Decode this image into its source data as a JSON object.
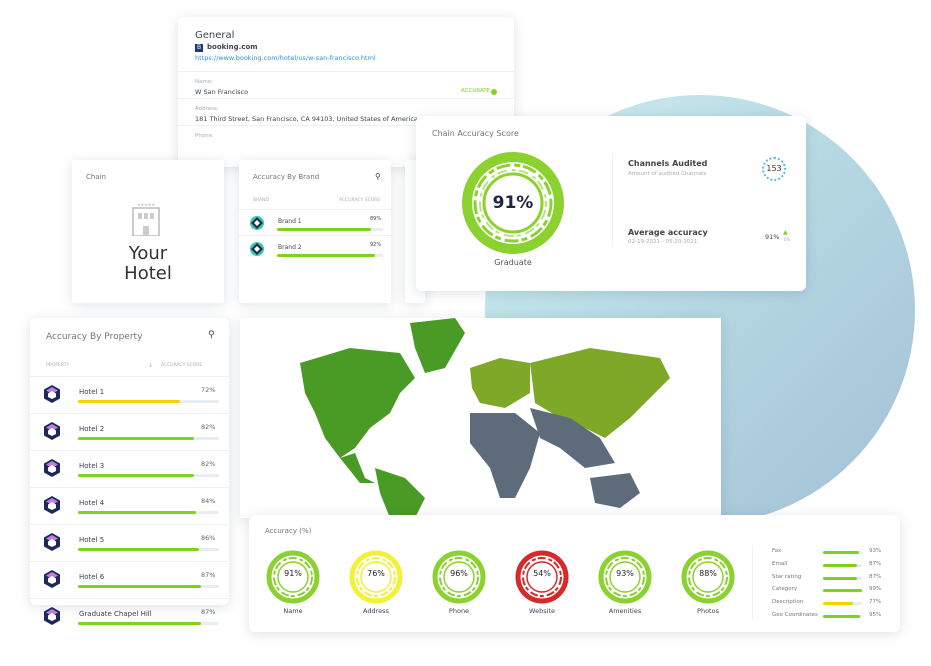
{
  "general": {
    "title": "General",
    "source": "booking.com",
    "url": "https://www.booking.com/hotel/us/w-san-francisco.html",
    "name_label": "Name:",
    "name_value": "W San Francisco",
    "status": "ACCURATE",
    "address_label": "Address:",
    "address_value": "181 Third Street, San Francisco, CA 94103, United States of America",
    "phone_label": "Phone:"
  },
  "chain": {
    "title": "Chain",
    "logo_line1": "Your",
    "logo_line2": "Hotel"
  },
  "brand": {
    "title": "Accuracy By Brand",
    "col_brand": "BRAND",
    "col_score": "ACCURACY SCORE",
    "rows": [
      {
        "name": "Brand 1",
        "score": "89%",
        "value": 89
      },
      {
        "name": "Brand 2",
        "score": "92%",
        "value": 92
      }
    ]
  },
  "chain_score": {
    "title": "Chain Accuracy Score",
    "score": "91%",
    "value": 91,
    "tier": "Graduate",
    "channels_title": "Channels Audited",
    "channels_sub": "Amount of audited Channels",
    "channels_count": "153",
    "avg_title": "Average accuracy",
    "avg_range": "02-19-2021 - 05-20-2021",
    "avg_value": "91%",
    "avg_change": "0%"
  },
  "property": {
    "title": "Accuracy By Property",
    "col_property": "PROPERTY",
    "col_score": "ACCURACY SCORE",
    "rows": [
      {
        "name": "Hotel 1",
        "score": "72%",
        "value": 72,
        "color": "#f5d300"
      },
      {
        "name": "Hotel 2",
        "score": "82%",
        "value": 82,
        "color": "#7ed321"
      },
      {
        "name": "Hotel 3",
        "score": "82%",
        "value": 82,
        "color": "#7ed321"
      },
      {
        "name": "Hotel 4",
        "score": "84%",
        "value": 84,
        "color": "#7ed321"
      },
      {
        "name": "Hotel 5",
        "score": "86%",
        "value": 86,
        "color": "#7ed321"
      },
      {
        "name": "Hotel 6",
        "score": "87%",
        "value": 87,
        "color": "#7ed321"
      },
      {
        "name": "Graduate Chapel Hill",
        "score": "87%",
        "value": 87,
        "color": "#7ed321"
      }
    ]
  },
  "accuracy": {
    "title": "Accuracy (%)",
    "gauges": [
      {
        "label": "Name",
        "score": "91%",
        "color": "#8bd12f"
      },
      {
        "label": "Address",
        "score": "76%",
        "color": "#f2f03a"
      },
      {
        "label": "Phone",
        "score": "96%",
        "color": "#8bd12f"
      },
      {
        "label": "Website",
        "score": "54%",
        "color": "#d42a2a"
      },
      {
        "label": "Amenities",
        "score": "93%",
        "color": "#8bd12f"
      },
      {
        "label": "Photos",
        "score": "88%",
        "color": "#8bd12f"
      }
    ],
    "fields": [
      {
        "label": "Fax",
        "score": "93%",
        "value": 93,
        "color": "#7ed321"
      },
      {
        "label": "Email",
        "score": "87%",
        "value": 87,
        "color": "#7ed321"
      },
      {
        "label": "Star rating",
        "score": "87%",
        "value": 87,
        "color": "#7ed321"
      },
      {
        "label": "Category",
        "score": "99%",
        "value": 99,
        "color": "#7ed321"
      },
      {
        "label": "Description",
        "score": "77%",
        "value": 77,
        "color": "#f5d300"
      },
      {
        "label": "Geo Coordinates",
        "score": "95%",
        "value": 95,
        "color": "#7ed321"
      }
    ]
  },
  "colors": {
    "accent_green": "#7ed321",
    "map_dark_green": "#4a9a26",
    "map_light_green": "#7ea928",
    "map_gray": "#5e6b7a",
    "link": "#2d8fe0"
  }
}
